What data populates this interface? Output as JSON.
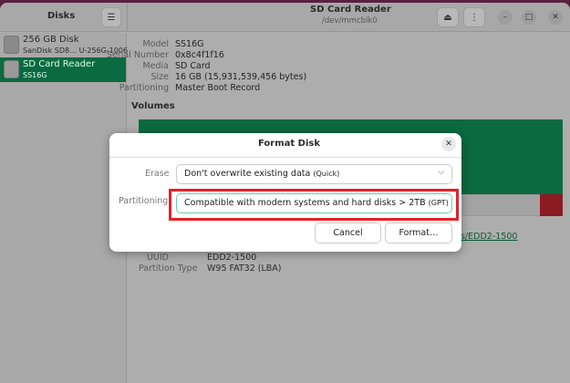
{
  "sidebar": {
    "title": "Disks",
    "menu_icon": "hamburger-icon",
    "items": [
      {
        "name": "256 GB Disk",
        "subtitle": "SanDisk SD8…  U-256G-1006",
        "icon": "ssd-icon",
        "selected": false
      },
      {
        "name": "SD Card Reader",
        "subtitle": "SS16G",
        "icon": "sd-card-icon",
        "selected": true
      }
    ]
  },
  "header": {
    "title": "SD Card Reader",
    "subtitle": "/dev/mmcblk0",
    "eject_icon": "eject-icon",
    "more_icon": "kebab-menu-icon"
  },
  "details": [
    {
      "label": "Model",
      "value": "SS16G"
    },
    {
      "label": "Serial Number",
      "value": "0x8c4f1f16"
    },
    {
      "label": "Media",
      "value": "SD Card"
    },
    {
      "label": "Size",
      "value": "16 GB (15,931,539,456 bytes)"
    },
    {
      "label": "Partitioning",
      "value": "Master Boot Record"
    }
  ],
  "volumes": {
    "heading": "Volumes",
    "link_fragment": "s/EDD2-1500",
    "uuid_label": "UUID",
    "uuid": "EDD2-1500",
    "ptype_label": "Partition Type",
    "ptype": "W95 FAT32 (LBA)"
  },
  "dialog": {
    "title": "Format Disk",
    "erase_label": "Erase",
    "erase_value": "Don't overwrite existing data",
    "erase_hint": "(Quick)",
    "partitioning_label": "Partitioning",
    "partitioning_value": "Compatible with modern systems and hard disks > 2TB",
    "partitioning_hint": "(GPT)",
    "cancel": "Cancel",
    "format": "Format…"
  },
  "colors": {
    "accent": "#0b6a40",
    "highlight": "#e8202a",
    "focus": "#6fcfb0"
  }
}
